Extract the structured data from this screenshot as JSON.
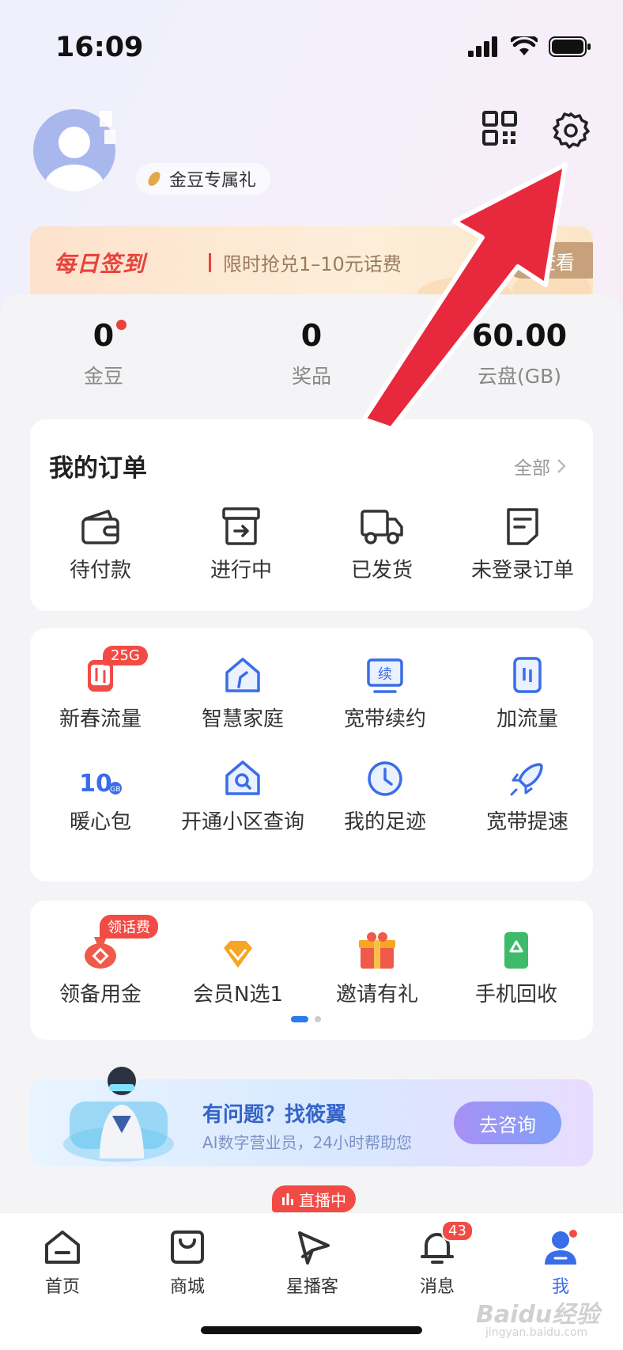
{
  "status_bar": {
    "time": "16:09"
  },
  "profile": {
    "gift_label": "金豆专属礼"
  },
  "signin_banner": {
    "title": "每日签到",
    "description": "限时抢兑1–10元话费",
    "button": "查看"
  },
  "stats": [
    {
      "value": "0",
      "label": "金豆",
      "dot": true
    },
    {
      "value": "0",
      "label": "奖品"
    },
    {
      "value": "60.00",
      "label": "云盘(GB)"
    }
  ],
  "orders": {
    "title": "我的订单",
    "all_label": "全部",
    "items": [
      {
        "label": "待付款",
        "icon": "wallet-icon"
      },
      {
        "label": "进行中",
        "icon": "box-arrow-icon"
      },
      {
        "label": "已发货",
        "icon": "truck-icon"
      },
      {
        "label": "未登录订单",
        "icon": "document-icon"
      }
    ]
  },
  "services": {
    "items": [
      {
        "label": "新春流量",
        "icon": "data-flow-icon",
        "badge": "25G"
      },
      {
        "label": "智慧家庭",
        "icon": "smart-home-icon"
      },
      {
        "label": "宽带续约",
        "icon": "broadband-renew-icon",
        "icon_text": "续"
      },
      {
        "label": "加流量",
        "icon": "add-data-icon"
      },
      {
        "label": "暖心包",
        "icon": "warm-pack-icon",
        "icon_text": "10",
        "icon_unit": "GB"
      },
      {
        "label": "开通小区查询",
        "icon": "home-search-icon"
      },
      {
        "label": "我的足迹",
        "icon": "clock-icon"
      },
      {
        "label": "宽带提速",
        "icon": "rocket-icon"
      }
    ]
  },
  "promos": {
    "items": [
      {
        "label": "领备用金",
        "icon": "money-bag-icon",
        "badge": "领话费"
      },
      {
        "label": "会员N选1",
        "icon": "diamond-icon"
      },
      {
        "label": "邀请有礼",
        "icon": "gift-box-icon"
      },
      {
        "label": "手机回收",
        "icon": "phone-recycle-icon"
      }
    ],
    "page_count": 2,
    "active_page": 1
  },
  "assistant": {
    "title": "有问题？找筱翼",
    "subtitle": "AI数字营业员，24小时帮助您",
    "button": "去咨询"
  },
  "bottom_nav": {
    "live_badge": "直播中",
    "items": [
      {
        "label": "首页",
        "icon": "home-icon"
      },
      {
        "label": "商城",
        "icon": "shopping-bag-icon"
      },
      {
        "label": "星播客",
        "icon": "play-icon"
      },
      {
        "label": "消息",
        "icon": "bell-icon",
        "badge": "43"
      },
      {
        "label": "我",
        "icon": "person-icon",
        "active": true
      }
    ]
  },
  "watermark": {
    "brand": "Baidu经验",
    "url": "jingyan.baidu.com"
  },
  "colors": {
    "accent_blue": "#3a6de8",
    "badge_red": "#f24b45",
    "signin_red": "#e8423c",
    "pointer_arrow": "#e8283c"
  }
}
